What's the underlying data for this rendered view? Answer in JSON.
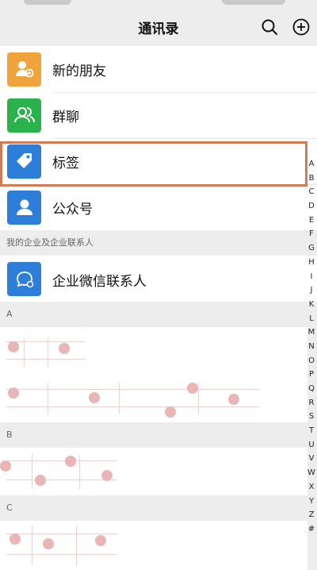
{
  "header": {
    "title": "通讯录",
    "search_icon": "search-icon",
    "add_icon": "plus-circle-icon"
  },
  "fixed_items": [
    {
      "label": "新的朋友",
      "icon": "add-person-icon",
      "color": "#f0a23b"
    },
    {
      "label": "群聊",
      "icon": "group-icon",
      "color": "#2bb24c"
    },
    {
      "label": "标签",
      "icon": "tag-icon",
      "color": "#2d7ed8"
    },
    {
      "label": "公众号",
      "icon": "person-icon",
      "color": "#2d7ed8"
    }
  ],
  "enterprise": {
    "section_title": "我的企业及企业联系人",
    "item_label": "企业微信联系人",
    "icon": "chat-bubble-icon",
    "color": "#2d7ed8"
  },
  "contact_sections": [
    "A",
    "B",
    "C"
  ],
  "index_letters": [
    "A",
    "B",
    "C",
    "D",
    "E",
    "F",
    "G",
    "H",
    "I",
    "J",
    "K",
    "L",
    "M",
    "N",
    "O",
    "P",
    "Q",
    "R",
    "S",
    "T",
    "U",
    "V",
    "W",
    "X",
    "Y",
    "Z",
    "#"
  ],
  "highlight_color": "#cf7b55"
}
